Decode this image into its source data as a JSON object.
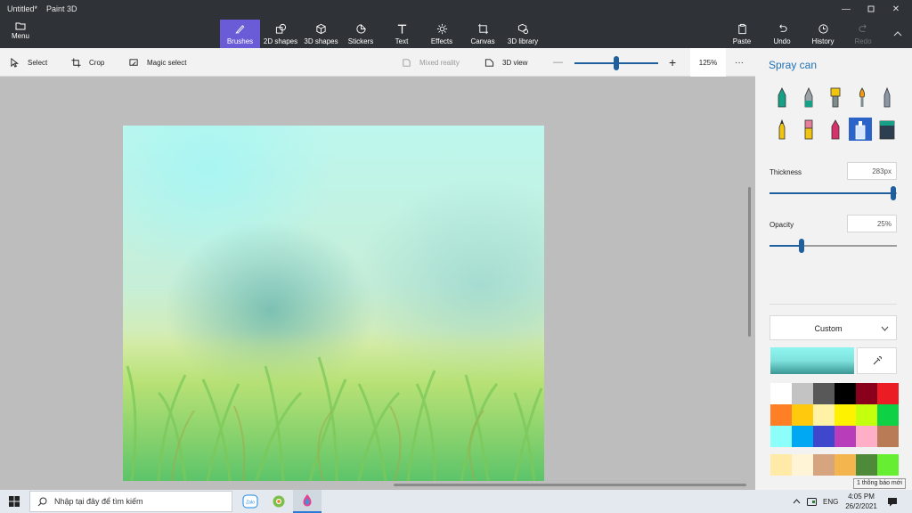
{
  "window": {
    "title": "Untitled*",
    "app": "Paint 3D"
  },
  "menu": {
    "label": "Menu"
  },
  "ribbon": {
    "tabs": [
      {
        "label": "Brushes",
        "icon": "brush-icon"
      },
      {
        "label": "2D shapes",
        "icon": "shapes-2d-icon"
      },
      {
        "label": "3D shapes",
        "icon": "cube-icon"
      },
      {
        "label": "Stickers",
        "icon": "sticker-icon"
      },
      {
        "label": "Text",
        "icon": "text-icon"
      },
      {
        "label": "Effects",
        "icon": "sun-icon"
      },
      {
        "label": "Canvas",
        "icon": "canvas-icon"
      },
      {
        "label": "3D library",
        "icon": "library-icon"
      }
    ],
    "right": [
      {
        "label": "Paste",
        "icon": "paste-icon"
      },
      {
        "label": "Undo",
        "icon": "undo-icon"
      },
      {
        "label": "History",
        "icon": "history-icon"
      },
      {
        "label": "Redo",
        "icon": "redo-icon"
      }
    ]
  },
  "toolbar": {
    "select": "Select",
    "crop": "Crop",
    "magic_select": "Magic select",
    "mixed_reality": "Mixed reality",
    "view3d": "3D view",
    "zoom": "125%",
    "more": "···"
  },
  "panel": {
    "title": "Spray can",
    "thickness_label": "Thickness",
    "thickness_value": "283px",
    "thickness_level": 0.97,
    "opacity_label": "Opacity",
    "opacity_value": "25%",
    "opacity_level": 0.25,
    "palette": "Custom",
    "current_color": "#7fe1dc",
    "swatches": [
      "#ffffff",
      "#c3c3c3",
      "#585858",
      "#000000",
      "#88001b",
      "#ec1c24",
      "#ff7f27",
      "#ffc90e",
      "#fff1a5",
      "#fff200",
      "#c4ff0e",
      "#0ed145",
      "#8cfffb",
      "#00a8f3",
      "#3f48cc",
      "#b83dba",
      "#ffaec8",
      "#b97a56"
    ],
    "custom_swatches": [
      "#ffeaa8",
      "#fff4d6",
      "#d6a57f",
      "#f4b54f",
      "#4f8a3a",
      "#66ee33"
    ]
  },
  "taskbar": {
    "search_placeholder": "Nhập tại đây để tìm kiếm",
    "lang": "ENG",
    "time": "4:05 PM",
    "date": "26/2/2021",
    "notification": "1 thông báo mới",
    "zalo_label": "Zalo"
  }
}
